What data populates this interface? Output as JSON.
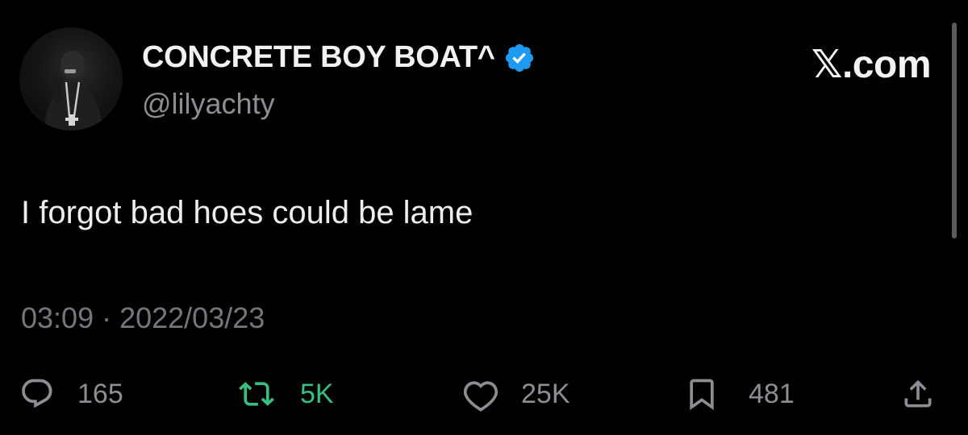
{
  "author": {
    "display_name": "CONCRETE BOY BOAT^",
    "handle": "@lilyachty",
    "verified": true
  },
  "brand": "𝕏.com",
  "tweet": {
    "text": "I forgot bad hoes could be lame",
    "timestamp": "03:09 · 2022/03/23"
  },
  "actions": {
    "reply": {
      "icon": "reply-icon",
      "count": "165"
    },
    "retweet": {
      "icon": "retweet-icon",
      "count": "5K"
    },
    "like": {
      "icon": "heart-icon",
      "count": "25K"
    },
    "bookmark": {
      "icon": "bookmark-icon",
      "count": "481"
    },
    "share": {
      "icon": "share-icon"
    }
  },
  "colors": {
    "background": "#000000",
    "verified_blue": "#1d9bf0",
    "retweet_green": "#3bbd7f",
    "muted_text": "#8b8f93"
  }
}
